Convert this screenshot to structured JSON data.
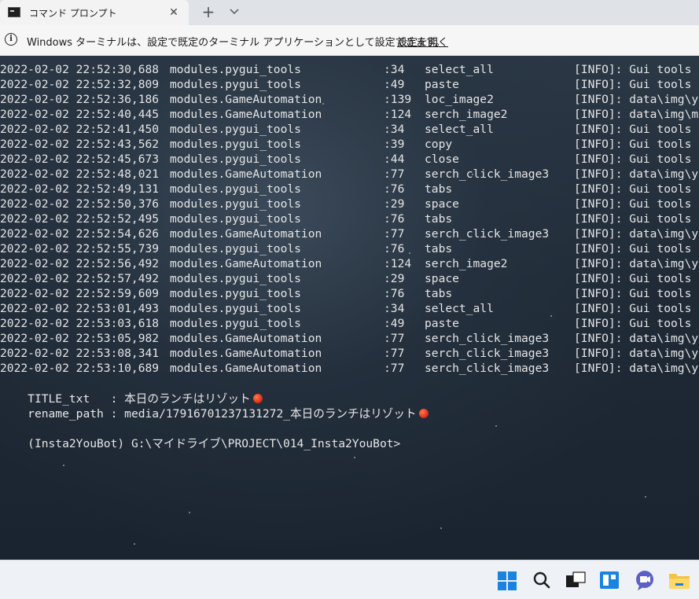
{
  "tab": {
    "title": "コマンド プロンプト",
    "close_glyph": "✕"
  },
  "new_tab_glyph": "+",
  "dropdown_glyph": "⌄",
  "infobar": {
    "icon": "i",
    "message": "Windows ターミナルは、設定で既定のターミナル アプリケーションとして設定できます。",
    "link": "設定を開く"
  },
  "log_rows": [
    {
      "ts": "2022-02-02 22:52:30,688",
      "module": "modules.pygui_tools",
      "line": ":34",
      "func": "select_all",
      "msg": "[INFO]: Gui tools"
    },
    {
      "ts": "2022-02-02 22:52:32,809",
      "module": "modules.pygui_tools",
      "line": ":49",
      "func": "paste",
      "msg": "[INFO]: Gui tools"
    },
    {
      "ts": "2022-02-02 22:52:36,186",
      "module": "modules.GameAutomation",
      "line": ":139",
      "func": "loc_image2",
      "msg": "[INFO]: data\\img\\y"
    },
    {
      "ts": "2022-02-02 22:52:40,445",
      "module": "modules.GameAutomation",
      "line": ":124",
      "func": "serch_image2",
      "msg": "[INFO]: data\\img\\m"
    },
    {
      "ts": "2022-02-02 22:52:41,450",
      "module": "modules.pygui_tools",
      "line": ":34",
      "func": "select_all",
      "msg": "[INFO]: Gui tools"
    },
    {
      "ts": "2022-02-02 22:52:43,562",
      "module": "modules.pygui_tools",
      "line": ":39",
      "func": "copy",
      "msg": "[INFO]: Gui tools"
    },
    {
      "ts": "2022-02-02 22:52:45,673",
      "module": "modules.pygui_tools",
      "line": ":44",
      "func": "close",
      "msg": "[INFO]: Gui tools"
    },
    {
      "ts": "2022-02-02 22:52:48,021",
      "module": "modules.GameAutomation",
      "line": ":77",
      "func": "serch_click_image3",
      "msg": "[INFO]: data\\img\\y"
    },
    {
      "ts": "2022-02-02 22:52:49,131",
      "module": "modules.pygui_tools",
      "line": ":76",
      "func": "tabs",
      "msg": "[INFO]: Gui tools"
    },
    {
      "ts": "2022-02-02 22:52:50,376",
      "module": "modules.pygui_tools",
      "line": ":29",
      "func": "space",
      "msg": "[INFO]: Gui tools"
    },
    {
      "ts": "2022-02-02 22:52:52,495",
      "module": "modules.pygui_tools",
      "line": ":76",
      "func": "tabs",
      "msg": "[INFO]: Gui tools"
    },
    {
      "ts": "2022-02-02 22:52:54,626",
      "module": "modules.GameAutomation",
      "line": ":77",
      "func": "serch_click_image3",
      "msg": "[INFO]: data\\img\\y"
    },
    {
      "ts": "2022-02-02 22:52:55,739",
      "module": "modules.pygui_tools",
      "line": ":76",
      "func": "tabs",
      "msg": "[INFO]: Gui tools"
    },
    {
      "ts": "2022-02-02 22:52:56,492",
      "module": "modules.GameAutomation",
      "line": ":124",
      "func": "serch_image2",
      "msg": "[INFO]: data\\img\\y"
    },
    {
      "ts": "2022-02-02 22:52:57,492",
      "module": "modules.pygui_tools",
      "line": ":29",
      "func": "space",
      "msg": "[INFO]: Gui tools"
    },
    {
      "ts": "2022-02-02 22:52:59,609",
      "module": "modules.pygui_tools",
      "line": ":76",
      "func": "tabs",
      "msg": "[INFO]: Gui tools"
    },
    {
      "ts": "2022-02-02 22:53:01,493",
      "module": "modules.pygui_tools",
      "line": ":34",
      "func": "select_all",
      "msg": "[INFO]: Gui tools"
    },
    {
      "ts": "2022-02-02 22:53:03,618",
      "module": "modules.pygui_tools",
      "line": ":49",
      "func": "paste",
      "msg": "[INFO]: Gui tools"
    },
    {
      "ts": "2022-02-02 22:53:05,982",
      "module": "modules.GameAutomation",
      "line": ":77",
      "func": "serch_click_image3",
      "msg": "[INFO]: data\\img\\y"
    },
    {
      "ts": "2022-02-02 22:53:08,341",
      "module": "modules.GameAutomation",
      "line": ":77",
      "func": "serch_click_image3",
      "msg": "[INFO]: data\\img\\y"
    },
    {
      "ts": "2022-02-02 22:53:10,689",
      "module": "modules.GameAutomation",
      "line": ":77",
      "func": "serch_click_image3",
      "msg": "[INFO]: data\\img\\y"
    }
  ],
  "title_line": "TITLE_txt   : 本日のランチはリゾット",
  "rename_line": "rename_path : media/17916701237131272_本日のランチはリゾット",
  "prompt": "(Insta2YouBot) G:\\マイドライブ\\PROJECT\\014_Insta2YouBot>",
  "taskbar": {
    "icons": [
      "windows-start-icon",
      "search-icon",
      "task-view-icon",
      "widgets-icon",
      "chat-icon",
      "file-explorer-icon"
    ]
  },
  "colors": {
    "accent": "#1a83e0",
    "terminal_text": "#e6e6e6",
    "emoji": "#e0331c"
  }
}
